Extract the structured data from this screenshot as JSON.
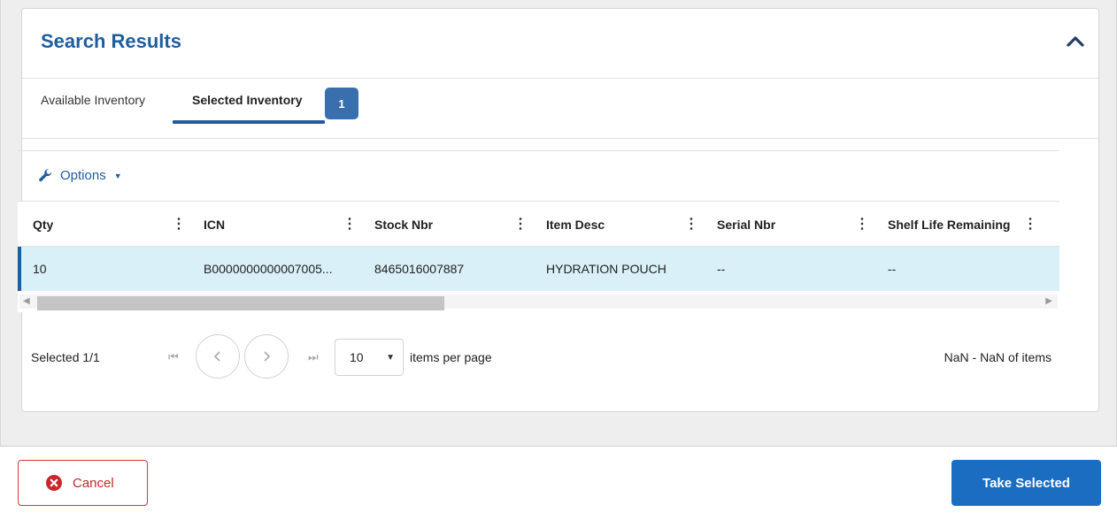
{
  "panel": {
    "title": "Search Results"
  },
  "tabs": [
    {
      "label": "Available Inventory"
    },
    {
      "label": "Selected Inventory",
      "badge": "1"
    }
  ],
  "toolbar": {
    "options_label": "Options"
  },
  "table": {
    "columns": [
      "Qty",
      "ICN",
      "Stock Nbr",
      "Item Desc",
      "Serial Nbr",
      "Shelf Life Remaining"
    ],
    "rows": [
      {
        "qty": "10",
        "icn": "B0000000000007005...",
        "stock_nbr": "8465016007887",
        "item_desc": "HYDRATION POUCH",
        "serial_nbr": "--",
        "shelf_life": "--"
      }
    ]
  },
  "pager": {
    "status": "Selected 1/1",
    "page_size": "10",
    "items_per_page_label": "items per page",
    "range": "NaN - NaN of items"
  },
  "footer": {
    "cancel_label": "Cancel",
    "take_label": "Take Selected"
  },
  "colors": {
    "accent": "#1f5d9e",
    "selected_row": "#d9f0f8",
    "primary_button": "#1a6dc1",
    "danger": "#d8363a"
  }
}
